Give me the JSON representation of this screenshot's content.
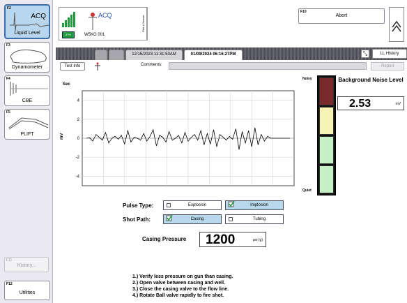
{
  "sidebar": {
    "keys": [
      {
        "key": "F2",
        "label": "Liquid Level",
        "badge": "ACQ",
        "active": true
      },
      {
        "key": "F3",
        "label": "Dynamometer",
        "active": false
      },
      {
        "key": "F4",
        "label": "CBE",
        "active": false
      },
      {
        "key": "F5",
        "label": "PLIFT",
        "active": false
      }
    ],
    "history": {
      "key": "F11",
      "label": "History..."
    },
    "utilities": {
      "key": "F12",
      "label": "Utilities"
    }
  },
  "top": {
    "well_name": "W5KG 001",
    "battery": "87%",
    "acq_badge": "ACQ",
    "sensor_tag": "Pick a Sensor",
    "abort": {
      "key": "F10",
      "label": "Abort"
    }
  },
  "tabs": [
    {
      "label": "",
      "state": "dim"
    },
    {
      "label": "",
      "state": "dim"
    },
    {
      "label": "12/15/2023 11:31:53AM",
      "state": "old"
    },
    {
      "label": "01/09/2024 06:16:27PM",
      "state": "current"
    }
  ],
  "toolbar": {
    "test_info": "Test Info",
    "comments_label": "Comments:",
    "comments_value": "",
    "report": "Report",
    "ll_history": "LL History"
  },
  "chart_data": {
    "type": "line",
    "title": "",
    "ylabel_top": "Sec",
    "ylabel": "mV",
    "xlabel": "",
    "ylim": [
      -5,
      5
    ],
    "yticks": [
      "4",
      "2",
      "0",
      "-2",
      "-4"
    ],
    "xlim": [
      0,
      10
    ],
    "grid": true,
    "series": [
      {
        "x": [
          0.2,
          0.35,
          0.5,
          0.65,
          0.8,
          0.95,
          1.1,
          1.25,
          1.4,
          1.55,
          1.7,
          1.85,
          2.0,
          2.15,
          2.3,
          2.45,
          2.6,
          2.75,
          2.9,
          3.05,
          3.2,
          3.35,
          3.5,
          3.65,
          3.8,
          3.95,
          4.1,
          4.25,
          4.4,
          4.55,
          4.7,
          4.85,
          5.0,
          5.15,
          5.3,
          5.45,
          5.6,
          5.75,
          5.9,
          6.05,
          6.2,
          6.35,
          6.5,
          6.65,
          6.8,
          6.95,
          7.1,
          7.25,
          7.4,
          7.55,
          7.7,
          7.85,
          8.0,
          8.15,
          8.3,
          8.45,
          8.6,
          8.75,
          8.9,
          9.05,
          9.2,
          9.35,
          9.5,
          9.65,
          9.8
        ],
        "y": [
          0.0,
          0.05,
          -0.3,
          0.4,
          0.1,
          -0.2,
          0.6,
          -0.5,
          0.0,
          0.2,
          -0.1,
          0.3,
          -0.6,
          0.8,
          -0.4,
          0.1,
          0.0,
          -0.2,
          0.5,
          -0.3,
          0.2,
          0.9,
          -0.8,
          0.3,
          0.1,
          -0.4,
          0.7,
          -0.2,
          0.0,
          0.3,
          -0.5,
          0.6,
          -0.3,
          0.1,
          0.4,
          -0.2,
          0.8,
          -0.7,
          0.5,
          -0.6,
          0.9,
          -0.9,
          0.4,
          0.1,
          -0.2,
          0.2,
          -0.1,
          1.0,
          -1.2,
          0.7,
          -0.5,
          0.8,
          -0.9,
          1.1,
          -0.7,
          0.4,
          -0.3,
          0.2,
          0.0,
          0.0,
          0.0,
          0.0,
          0.0,
          0.0,
          0.0
        ]
      }
    ]
  },
  "noise": {
    "noisy_label": "Noisy",
    "quiet_label": "Quiet",
    "title": "Background Noise Level",
    "value": "2.53",
    "unit": "mV",
    "segments": [
      {
        "color": "#7a2a2a"
      },
      {
        "color": "#f6f4b4"
      },
      {
        "color": "#c6f0c6"
      },
      {
        "color": "#c6f0c6"
      }
    ],
    "level_fraction": 0.5
  },
  "pulse_type": {
    "label": "Pulse Type:",
    "options": [
      {
        "label": "Explosion",
        "selected": false
      },
      {
        "label": "Implosion",
        "selected": true
      }
    ]
  },
  "shot_path": {
    "label": "Shot Path:",
    "options": [
      {
        "label": "Casing",
        "selected": true
      },
      {
        "label": "Tubing",
        "selected": false
      }
    ]
  },
  "casing_pressure": {
    "label": "Casing Pressure",
    "value": "1200",
    "unit": "psi (g)"
  },
  "instructions": [
    "1.) Verify less pressure on gun than casing.",
    "2.) Open valve between casing and well.",
    "3.) Close the casing valve to the flow line.",
    "4.) Rotate Ball valve rapidly to fire shot."
  ]
}
